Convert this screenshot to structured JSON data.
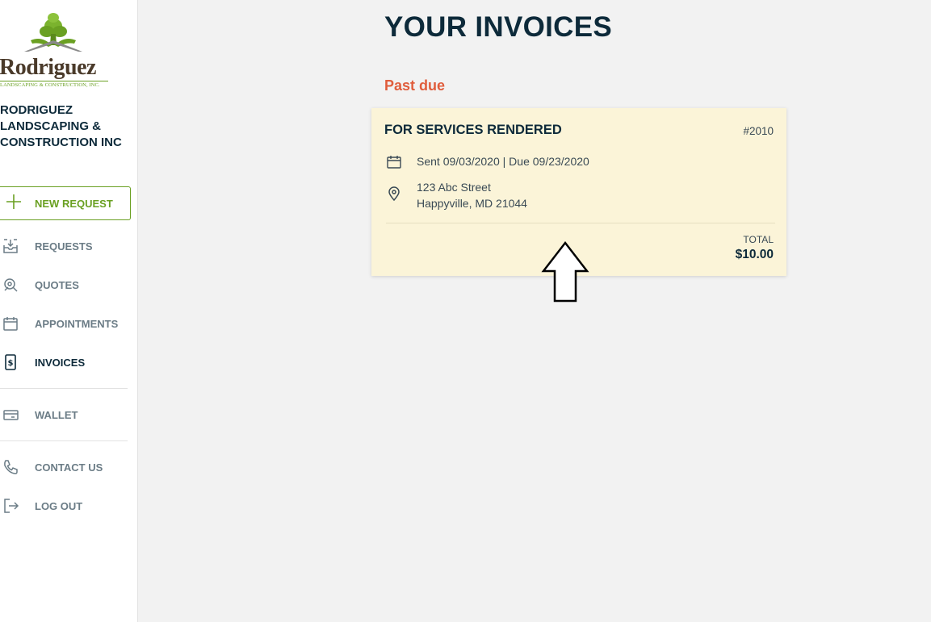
{
  "brand": {
    "logo_text": "Rodriguez",
    "logo_subtext": "LANDSCAPING & CONSTRUCTION, INC.",
    "company_name": "RODRIGUEZ LANDSCAPING & CONSTRUCTION INC",
    "accent_color": "#6aa022"
  },
  "sidebar": {
    "new_request_label": "NEW REQUEST",
    "items": [
      {
        "label": "REQUESTS",
        "icon": "inbox-download-icon"
      },
      {
        "label": "QUOTES",
        "icon": "quote-magnifier-icon"
      },
      {
        "label": "APPOINTMENTS",
        "icon": "calendar-icon"
      },
      {
        "label": "INVOICES",
        "icon": "dollar-document-icon",
        "active": true
      },
      {
        "label": "WALLET",
        "icon": "credit-card-icon"
      },
      {
        "label": "CONTACT US",
        "icon": "phone-icon"
      },
      {
        "label": "LOG OUT",
        "icon": "logout-icon"
      }
    ]
  },
  "main": {
    "title": "YOUR INVOICES",
    "section_label": "Past due",
    "section_color": "#e05d3c",
    "invoice": {
      "title": "FOR SERVICES RENDERED",
      "number": "#2010",
      "dates": "Sent 09/03/2020 | Due 09/23/2020",
      "address_line1": "123 Abc Street",
      "address_line2": "Happyville, MD 21044",
      "total_label": "TOTAL",
      "total_value": "$10.00",
      "background": "#fbf4d8"
    }
  }
}
